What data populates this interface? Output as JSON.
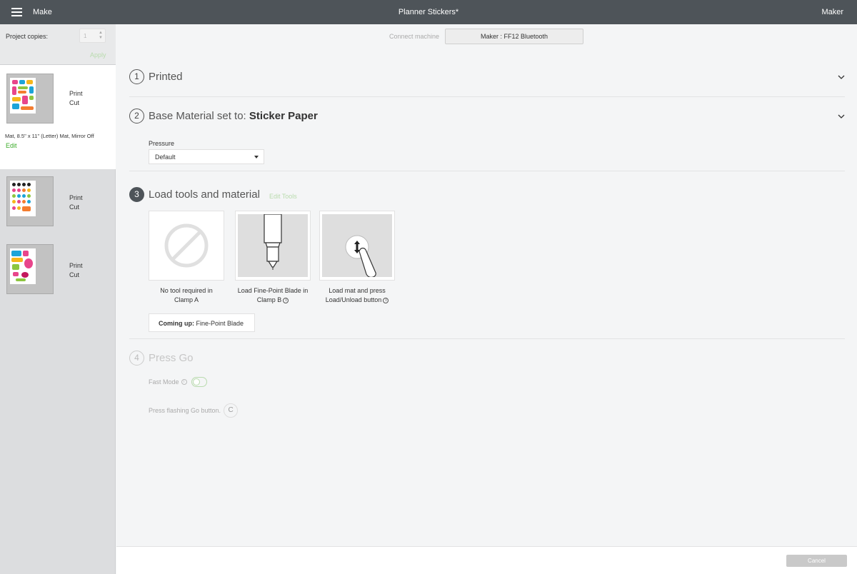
{
  "topbar": {
    "menu_icon": "hamburger-icon",
    "section": "Make",
    "title": "Planner Stickers*",
    "machine": "Maker"
  },
  "sidebar": {
    "copies_label": "Project copies:",
    "copies_value": "1",
    "apply_label": "Apply",
    "mats": [
      {
        "line1": "Print",
        "line2": "Cut",
        "info": "Mat, 8.5\" x 11\" (Letter) Mat, Mirror Off",
        "edit_label": "Edit",
        "selected": true
      },
      {
        "line1": "Print",
        "line2": "Cut",
        "selected": false
      },
      {
        "line1": "Print",
        "line2": "Cut",
        "selected": false
      }
    ]
  },
  "main": {
    "connect_label": "Connect machine",
    "connect_button": "Maker : FF12 Bluetooth",
    "steps": [
      {
        "num": "1",
        "title": "Printed"
      },
      {
        "num": "2",
        "title_prefix": "Base Material set to: ",
        "title_bold": "Sticker Paper"
      },
      {
        "num": "3",
        "title": "Load tools and material",
        "edit_tools": "Edit Tools"
      },
      {
        "num": "4",
        "title": "Press Go"
      }
    ],
    "pressure_label": "Pressure",
    "pressure_value": "Default",
    "tools": [
      {
        "icon": "no-tool-icon",
        "caption_line1": "No tool required in",
        "caption_line2": "Clamp A"
      },
      {
        "icon": "fine-point-blade-icon",
        "caption_line1": "Load Fine-Point Blade in",
        "caption_line2": "Clamp B"
      },
      {
        "icon": "load-unload-button-icon",
        "caption_line1": "Load mat and press",
        "caption_line2": "Load/Unload button"
      }
    ],
    "info_glyph": "i",
    "coming_up_label": "Coming up:",
    "coming_up_value": "Fine-Point Blade",
    "fast_mode_label": "Fast Mode",
    "press_go_label": "Press flashing Go button.",
    "go_glyph": "C"
  },
  "footer": {
    "cancel_label": "Cancel"
  },
  "colors": {
    "topbar": "#4e5459",
    "accent_green": "#3cac2a",
    "muted_green": "#b9dbae",
    "sidebar": "#dcdddf",
    "background": "#f4f5f6"
  }
}
